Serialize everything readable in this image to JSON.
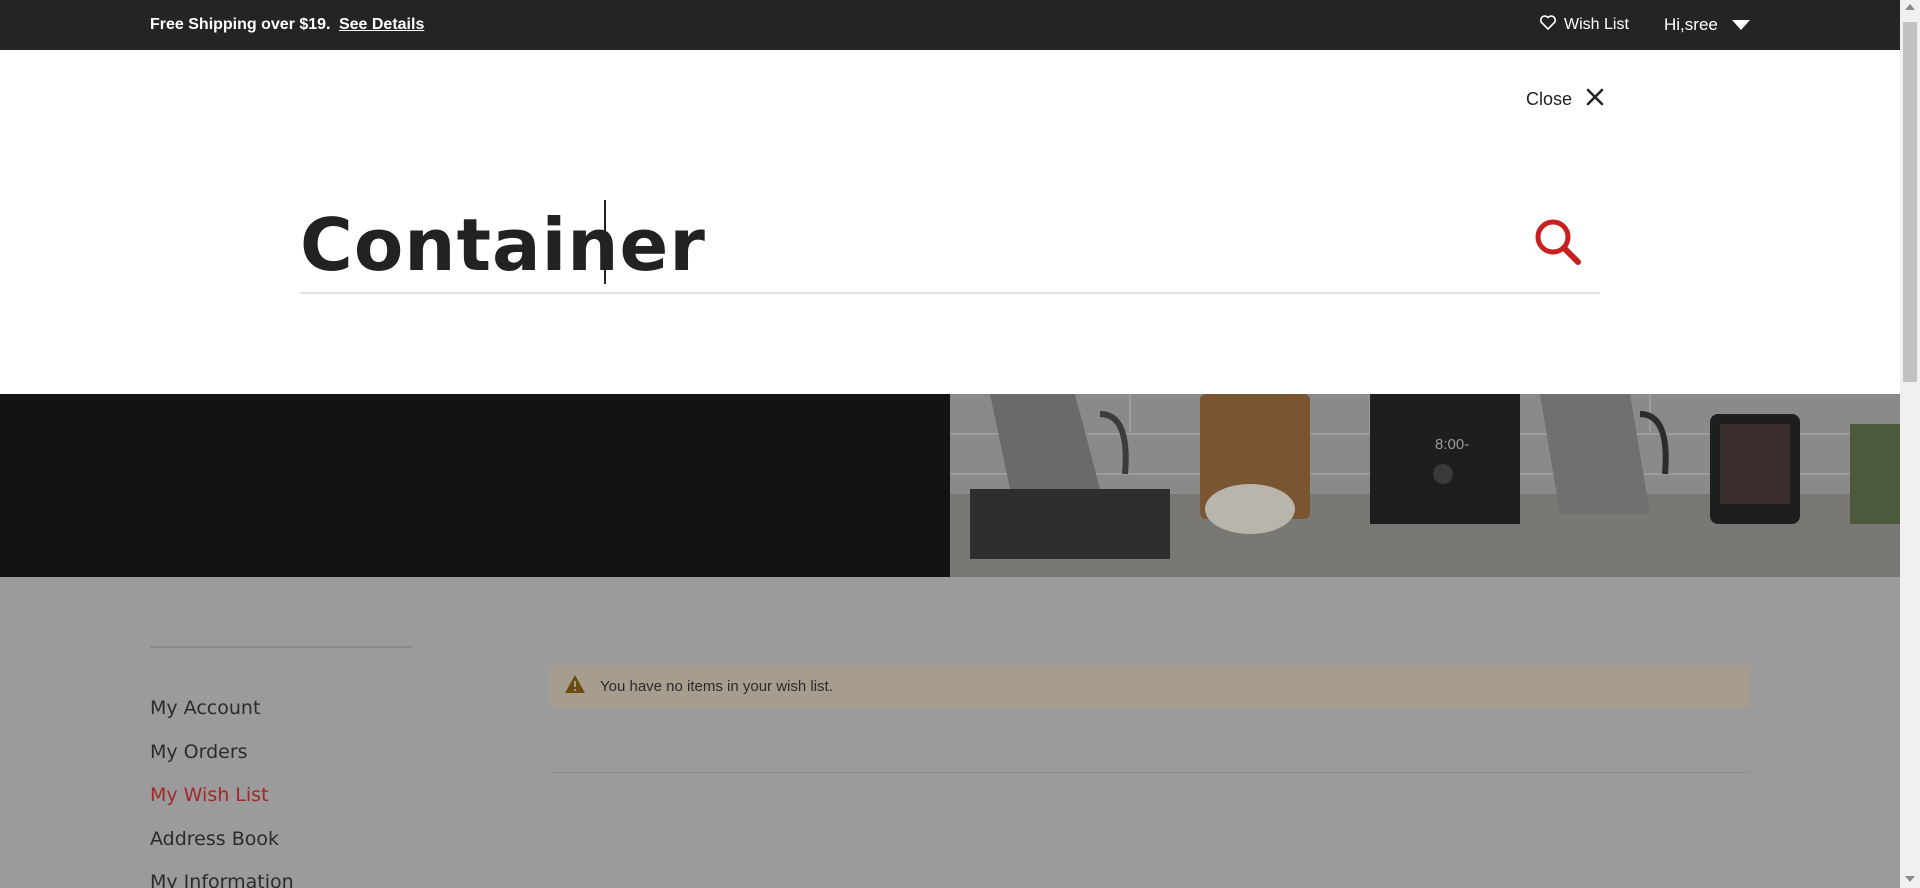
{
  "topbar": {
    "promo_text": "Free Shipping over $19.",
    "promo_link": "See Details",
    "wishlist_label": "Wish List",
    "greeting": "Hi,sree"
  },
  "search": {
    "close_label": "Close",
    "query": "Container"
  },
  "sidebar": {
    "items": [
      {
        "label": "My Account",
        "active": false
      },
      {
        "label": "My Orders",
        "active": false
      },
      {
        "label": "My Wish List",
        "active": true
      },
      {
        "label": "Address Book",
        "active": false
      },
      {
        "label": "My Information",
        "active": false
      }
    ]
  },
  "main": {
    "notice": "You have no items in your wish list."
  },
  "hero": {
    "clock_text": "8:00-"
  },
  "colors": {
    "topbar_bg": "#242424",
    "accent_red": "#c8201f",
    "active_nav": "#a3282a",
    "notice_bg": "#a69d8e"
  },
  "icons": [
    "heart-icon",
    "caret-down-icon",
    "close-icon",
    "search-icon",
    "warning-icon"
  ]
}
